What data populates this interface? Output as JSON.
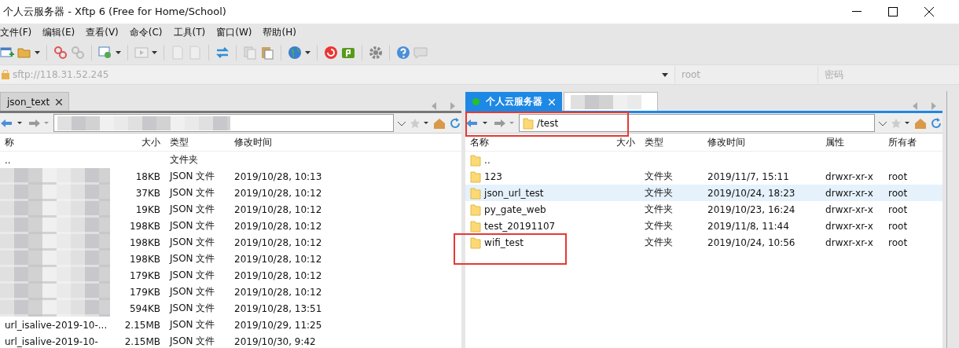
{
  "window": {
    "title": "个人云服务器 - Xftp 6 (Free for Home/School)"
  },
  "menu": [
    "文件(F)",
    "编辑(E)",
    "查看(V)",
    "命令(C)",
    "工具(T)",
    "窗口(W)",
    "帮助(H)"
  ],
  "address_bar": {
    "host": "sftp://118.31.52.245",
    "user_placeholder": "root",
    "password_placeholder": "密码"
  },
  "left_pane": {
    "tabs": [
      {
        "label": "json_text",
        "selected": true
      }
    ],
    "columns": [
      "称",
      "大小",
      "类型",
      "修改时间"
    ],
    "rows": [
      {
        "name": "..",
        "type": "文件夹"
      },
      {
        "size": "18KB",
        "type": "JSON 文件",
        "modified": "2019/10/28, 10:13"
      },
      {
        "size": "37KB",
        "type": "JSON 文件",
        "modified": "2019/10/28, 10:12"
      },
      {
        "size": "19KB",
        "type": "JSON 文件",
        "modified": "2019/10/28, 10:12"
      },
      {
        "size": "198KB",
        "type": "JSON 文件",
        "modified": "2019/10/28, 10:12"
      },
      {
        "size": "198KB",
        "type": "JSON 文件",
        "modified": "2019/10/28, 10:12"
      },
      {
        "size": "198KB",
        "type": "JSON 文件",
        "modified": "2019/10/28, 10:12"
      },
      {
        "size": "179KB",
        "type": "JSON 文件",
        "modified": "2019/10/28, 10:12"
      },
      {
        "size": "179KB",
        "type": "JSON 文件",
        "modified": "2019/10/28, 10:12"
      },
      {
        "size": "594KB",
        "type": "JSON 文件",
        "modified": "2019/10/28, 13:51"
      },
      {
        "name": "url_isalive-2019-10-...",
        "size": "2.15MB",
        "type": "JSON 文件",
        "modified": "2019/10/29, 11:25"
      },
      {
        "name": "url_isalive-2019-10-",
        "size": "2.15MB",
        "type": "JSON 文件",
        "modified": "2019/10/30, 9:42"
      }
    ]
  },
  "right_pane": {
    "tabs": [
      {
        "label": "个人云服务器",
        "selected": true,
        "connected": true
      },
      {
        "selected": false
      }
    ],
    "path": "/test",
    "columns": [
      "名称",
      "大小",
      "类型",
      "修改时间",
      "属性",
      "所有者"
    ],
    "rows": [
      {
        "name": "..",
        "selected": false
      },
      {
        "name": "123",
        "type": "文件夹",
        "modified": "2019/11/7, 15:11",
        "attributes": "drwxr-xr-x",
        "owner": "root",
        "selected": false
      },
      {
        "name": "json_url_test",
        "type": "文件夹",
        "modified": "2019/10/24, 18:23",
        "attributes": "drwxr-xr-x",
        "owner": "root",
        "selected": true
      },
      {
        "name": "py_gate_web",
        "type": "文件夹",
        "modified": "2019/10/23, 16:24",
        "attributes": "drwxr-xr-x",
        "owner": "root",
        "selected": false
      },
      {
        "name": "test_20191107",
        "type": "文件夹",
        "modified": "2019/11/8, 11:44",
        "attributes": "drwxr-xr-x",
        "owner": "root",
        "selected": false
      },
      {
        "name": "wifi_test",
        "type": "文件夹",
        "modified": "2019/10/24, 10:56",
        "attributes": "drwxr-xr-x",
        "owner": "root",
        "selected": false
      }
    ]
  }
}
